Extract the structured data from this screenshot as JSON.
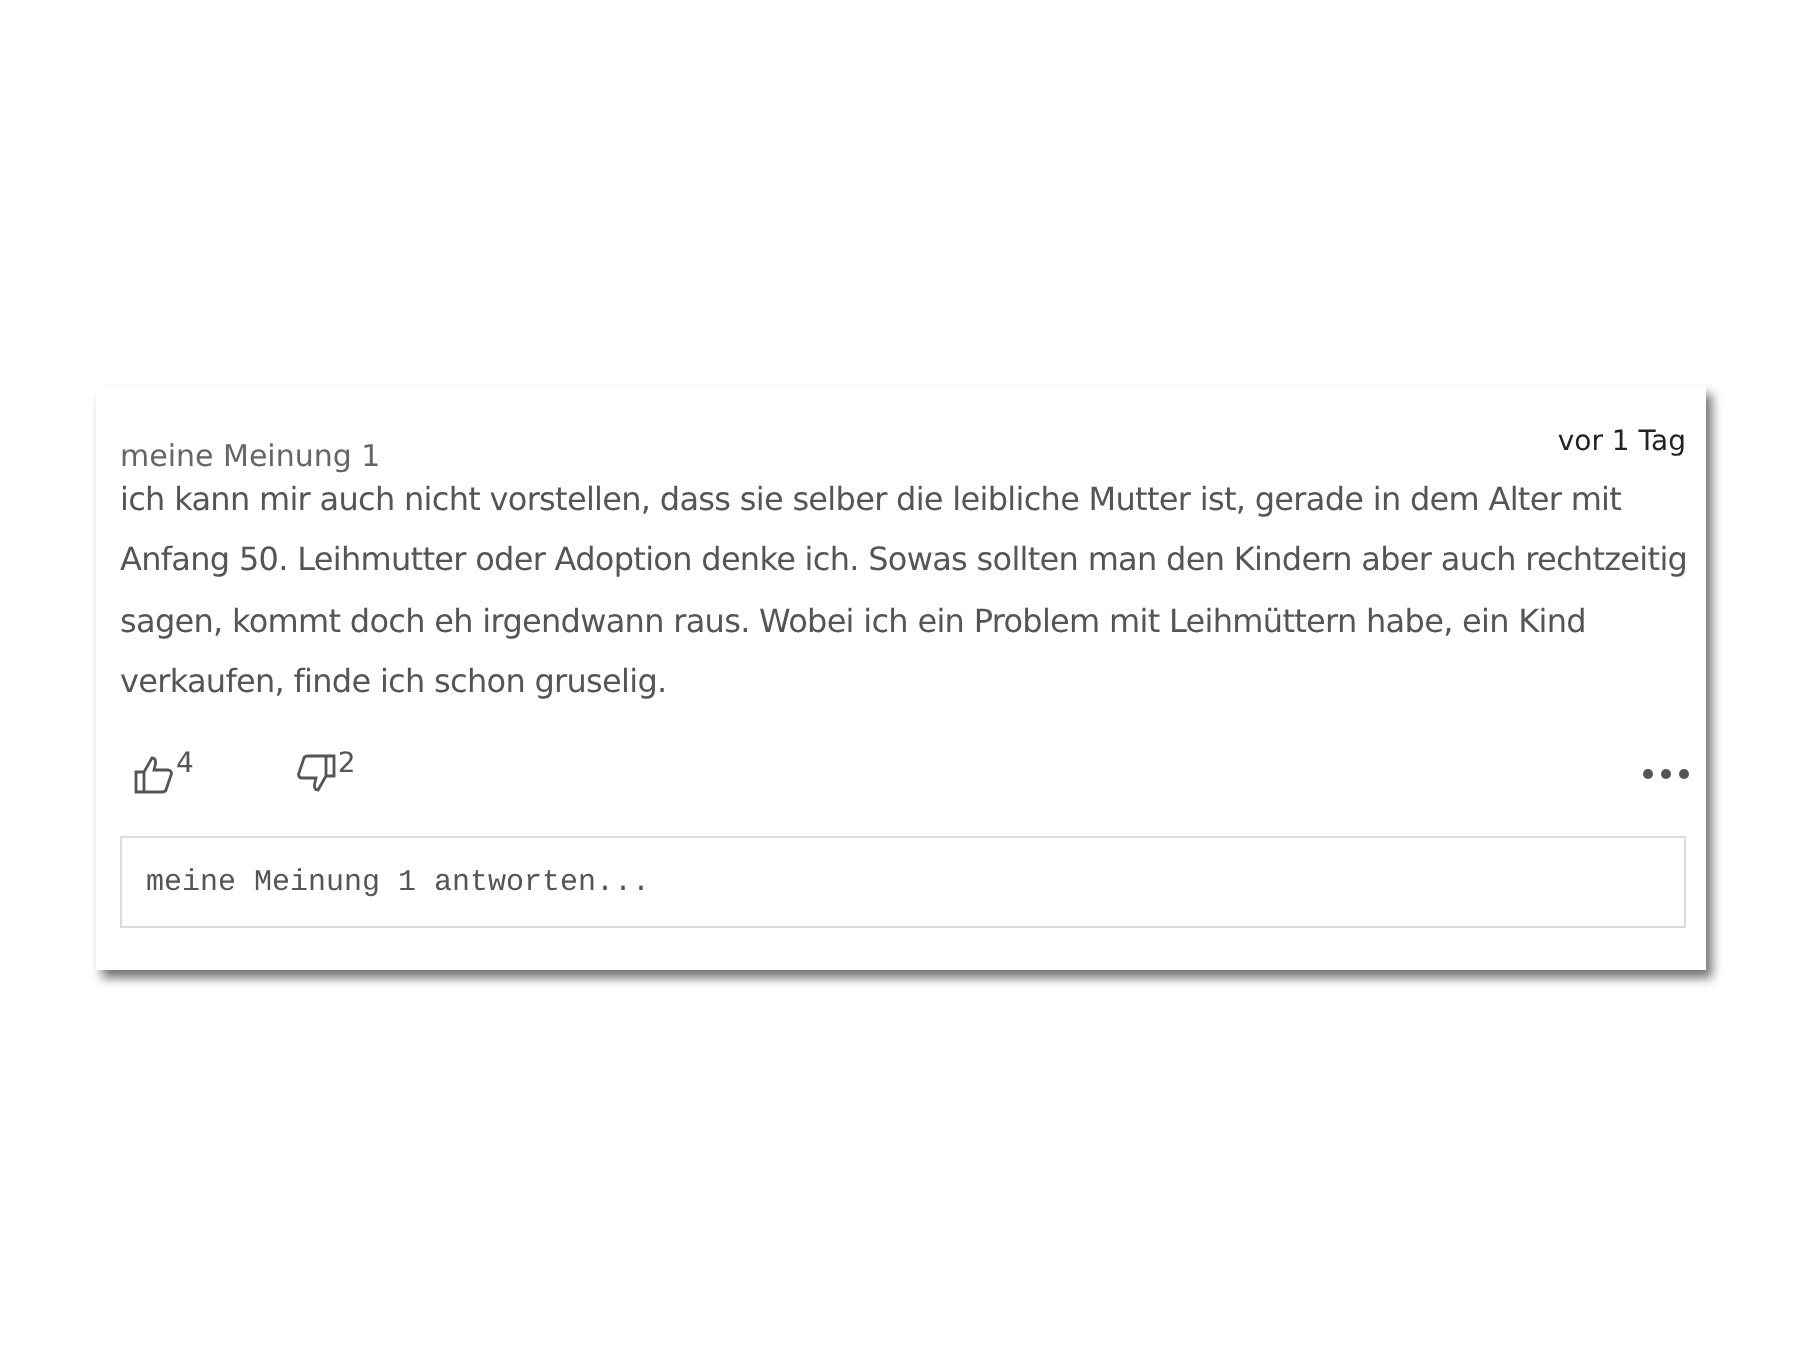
{
  "comment": {
    "author": "meine Meinung 1",
    "time": "vor 1 Tag",
    "text": "ich kann mir auch nicht vorstellen, dass sie selber die leibliche Mutter ist, gerade in dem Alter mit Anfang 50. Leihmutter oder Adoption denke ich. Sowas sollten man den Kindern aber auch rechtzeitig sagen, kommt doch eh irgendwann raus. Wobei ich ein Problem mit Leihmüttern habe, ein Kind verkaufen, finde ich schon gruselig.",
    "likes": "4",
    "dislikes": "2"
  },
  "reply": {
    "placeholder": "meine Meinung 1 antworten..."
  }
}
